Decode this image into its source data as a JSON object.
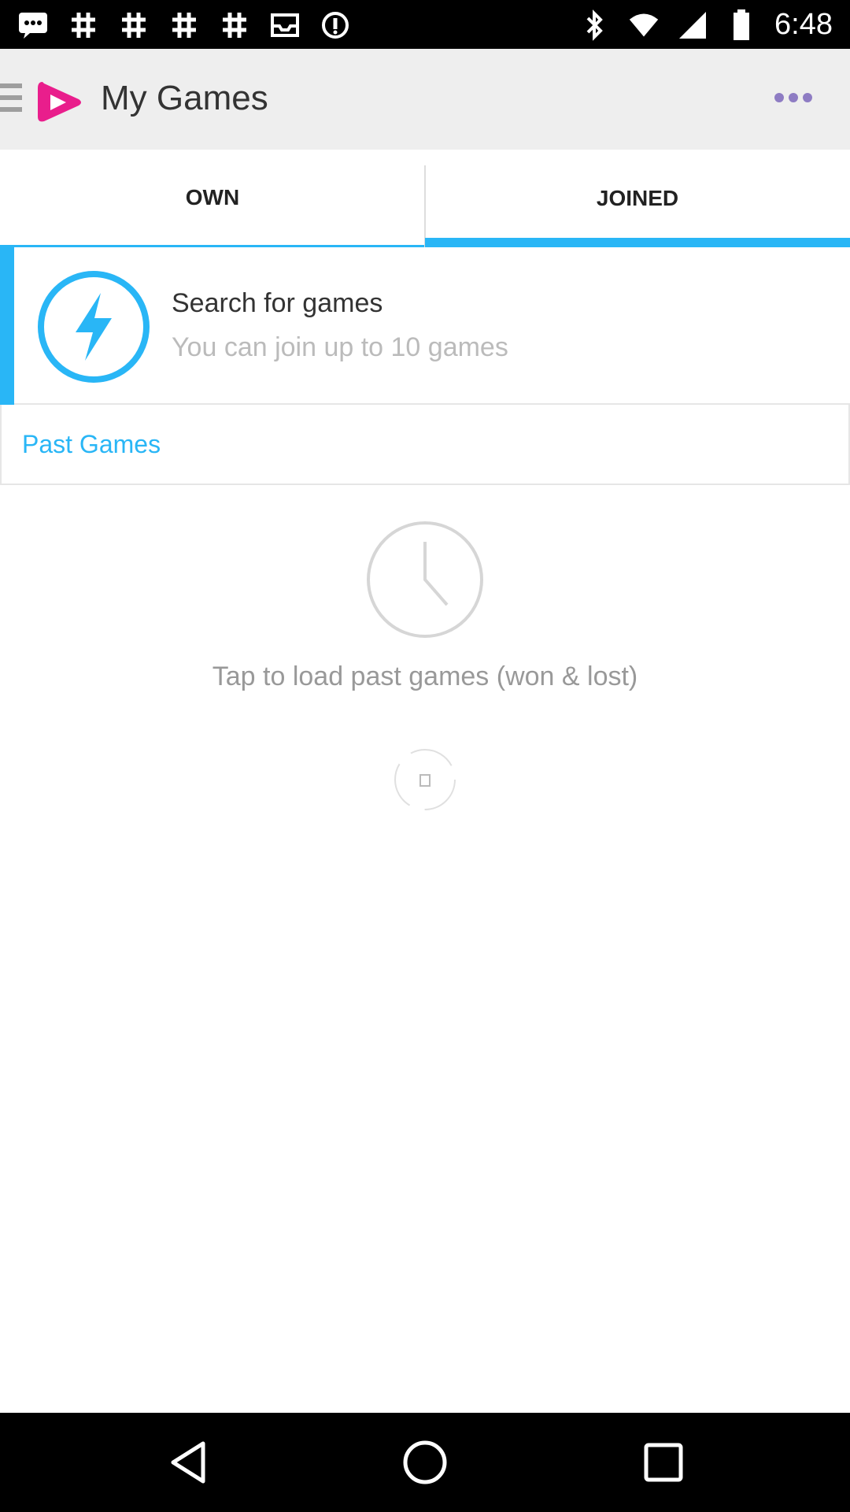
{
  "status_bar": {
    "time": "6:48",
    "left_icons": [
      "chat-icon",
      "hashtag-icon",
      "hashtag-icon",
      "hashtag-icon",
      "hashtag-icon",
      "inbox-icon",
      "info-icon"
    ],
    "right_icons": [
      "bluetooth-icon",
      "wifi-icon",
      "signal-icon",
      "battery-icon"
    ]
  },
  "app_bar": {
    "title": "My Games",
    "menu_icon": "menu-icon",
    "logo_icon": "play-heart-logo",
    "overflow_icon": "more-dots-icon"
  },
  "tabs": [
    {
      "label": "OWN",
      "selected": false
    },
    {
      "label": "JOINED",
      "selected": true
    }
  ],
  "search_card": {
    "title": "Search for games",
    "subtitle": "You can join up to 10 games",
    "icon": "lightning-icon"
  },
  "past_games": {
    "header": "Past Games",
    "empty_icon": "clock-icon",
    "empty_text": "Tap to load past games (won & lost)"
  },
  "colors": {
    "accent": "#29b6f6",
    "brand": "#e91e8c",
    "app_bar_bg": "#eeeeee",
    "overflow_dots": "#8e7cc3"
  },
  "nav_bar": {
    "buttons": [
      "back-icon",
      "home-icon",
      "recent-apps-icon"
    ]
  }
}
